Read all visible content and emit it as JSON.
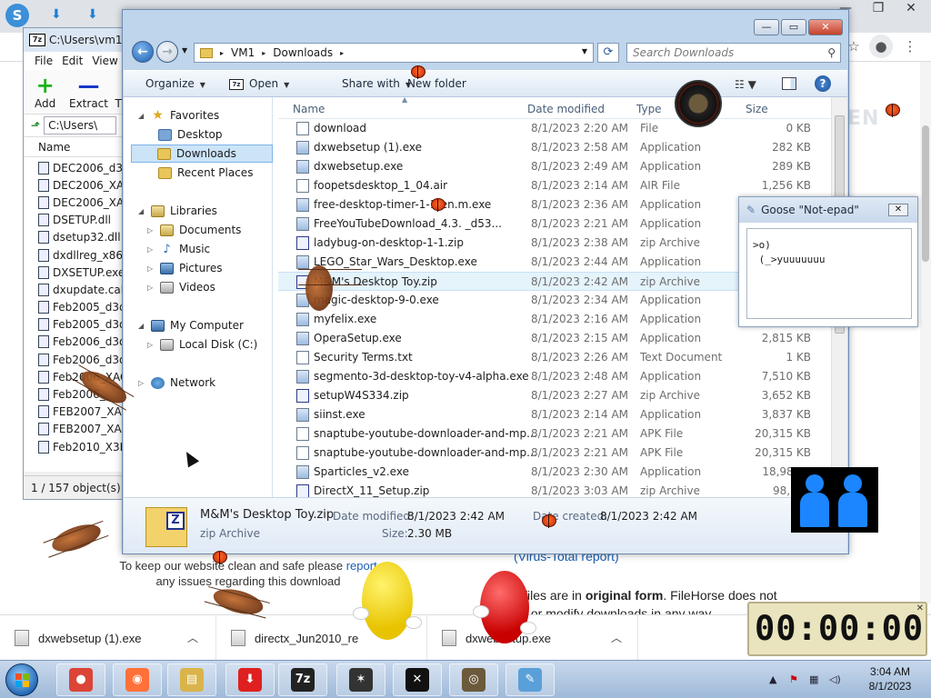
{
  "browser": {
    "window_controls": [
      "—",
      "❐",
      "✕"
    ],
    "watermark": "EN",
    "page_link": "(Virus-Total report)",
    "notice_text": "To keep our website clean and safe please",
    "notice_link": "report",
    "notice_text2": "any issues regarding this download",
    "original_line1_pre": "ll files are in",
    "original_line1_bold": "original form",
    "original_line1_post": ". FileHorse does not",
    "original_line2": "ck or modify downloads in any way"
  },
  "downloads_bar": {
    "items": [
      {
        "name": "dxwebsetup (1).exe"
      },
      {
        "name": "directx_Jun2010_re"
      },
      {
        "name": "dxwebsetup.exe"
      }
    ]
  },
  "sevenzip": {
    "title": "C:\\Users\\vm1\\",
    "logo": "7z",
    "menu": [
      "File",
      "Edit",
      "View"
    ],
    "tools": [
      {
        "label": "Add",
        "symbol": "+",
        "color": "#18b418"
      },
      {
        "label": "Extract",
        "symbol": "—",
        "color": "#1838c8"
      },
      {
        "label": "T",
        "symbol": "",
        "color": "#000000"
      }
    ],
    "path": "C:\\Users\\",
    "column_name": "Name",
    "files": [
      "DEC2006_d3dx",
      "DEC2006_XACT",
      "DEC2006_XACT",
      "DSETUP.dll",
      "dsetup32.dll",
      "dxdllreg_x86.ca",
      "DXSETUP.exe",
      "dxupdate.cab",
      "Feb2005_d3dx",
      "Feb2005_d3dx",
      "Feb2006_d3dx",
      "Feb2006_d3dx",
      "Feb2006_XACT",
      "Feb2006_",
      "FEB2007_XACT",
      "FEB2007_XACT",
      "Feb2010_X3DA"
    ],
    "status": "1 / 157 object(s) se"
  },
  "explorer": {
    "caption_buttons": {
      "minimize": "—",
      "maximize": "▭",
      "close": "✕"
    },
    "address": {
      "parts": [
        "VM1",
        "Downloads"
      ],
      "separator": "▸"
    },
    "search_placeholder": "Search Downloads",
    "commands": {
      "organize": "Organize",
      "open": "Open",
      "share_with": "Share with",
      "new_folder": "New folder",
      "open_badge": "7z"
    },
    "columns": {
      "name": "Name",
      "date": "Date modified",
      "type": "Type",
      "size": "Size"
    },
    "nav": {
      "favorites": "Favorites",
      "desktop": "Desktop",
      "downloads": "Downloads",
      "recent": "Recent Places",
      "libraries": "Libraries",
      "documents": "Documents",
      "music": "Music",
      "pictures": "Pictures",
      "videos": "Videos",
      "computer": "My Computer",
      "local_disk": "Local Disk (C:)",
      "network": "Network"
    },
    "files": [
      {
        "name": "download",
        "date": "8/1/2023 2:20 AM",
        "type": "File",
        "size": "0 KB",
        "kind": "file"
      },
      {
        "name": "dxwebsetup (1).exe",
        "date": "8/1/2023 2:58 AM",
        "type": "Application",
        "size": "282 KB",
        "kind": "exe"
      },
      {
        "name": "dxwebsetup.exe",
        "date": "8/1/2023 2:49 AM",
        "type": "Application",
        "size": "289 KB",
        "kind": "exe"
      },
      {
        "name": "foopetsdesktop_1_04.air",
        "date": "8/1/2023 2:14 AM",
        "type": "AIR File",
        "size": "1,256 KB",
        "kind": "file"
      },
      {
        "name": "free-desktop-timer-1-1-en.m.exe",
        "date": "8/1/2023 2:36 AM",
        "type": "Application",
        "size": "",
        "kind": "exe"
      },
      {
        "name": "FreeYouTubeDownload_4.3.      _d53...",
        "date": "8/1/2023 2:21 AM",
        "type": "Application",
        "size": "",
        "kind": "exe"
      },
      {
        "name": "ladybug-on-desktop-1-1.zip",
        "date": "8/1/2023 2:38 AM",
        "type": "zip Archive",
        "size": "",
        "kind": "zip"
      },
      {
        "name": "LEGO_Star_Wars_Desktop.exe",
        "date": "8/1/2023 2:44 AM",
        "type": "Application",
        "size": "",
        "kind": "exe"
      },
      {
        "name": "M&M's Desktop Toy.zip",
        "date": "8/1/2023 2:42 AM",
        "type": "zip Archive",
        "size": "",
        "kind": "zip"
      },
      {
        "name": "magic-desktop-9-0.exe",
        "date": "8/1/2023 2:34 AM",
        "type": "Application",
        "size": "",
        "kind": "exe"
      },
      {
        "name": "myfelix.exe",
        "date": "8/1/2023 2:16 AM",
        "type": "Application",
        "size": "",
        "kind": "exe"
      },
      {
        "name": "OperaSetup.exe",
        "date": "8/1/2023 2:15 AM",
        "type": "Application",
        "size": "2,815 KB",
        "kind": "exe"
      },
      {
        "name": "Security Terms.txt",
        "date": "8/1/2023 2:26 AM",
        "type": "Text Document",
        "size": "1 KB",
        "kind": "file"
      },
      {
        "name": "segmento-3d-desktop-toy-v4-alpha.exe",
        "date": "8/1/2023 2:48 AM",
        "type": "Application",
        "size": "7,510 KB",
        "kind": "exe"
      },
      {
        "name": "setupW4S334.zip",
        "date": "8/1/2023 2:27 AM",
        "type": "zip Archive",
        "size": "3,652 KB",
        "kind": "zip"
      },
      {
        "name": "siinst.exe",
        "date": "8/1/2023 2:14 AM",
        "type": "Application",
        "size": "3,837 KB",
        "kind": "exe"
      },
      {
        "name": "snaptube-youtube-downloader-and-mp...",
        "date": "8/1/2023 2:21 AM",
        "type": "APK File",
        "size": "20,315 KB",
        "kind": "file"
      },
      {
        "name": "snaptube-youtube-downloader-and-mp...",
        "date": "8/1/2023 2:21 AM",
        "type": "APK File",
        "size": "20,315 KB",
        "kind": "file"
      },
      {
        "name": "Sparticles_v2.exe",
        "date": "8/1/2023 2:30 AM",
        "type": "Application",
        "size": "18,985 K",
        "kind": "exe"
      },
      {
        "name": "DirectX_11_Setup.zip",
        "date": "8/1/2023 3:03 AM",
        "type": "zip Archive",
        "size": "98,297",
        "kind": "zip"
      }
    ],
    "details": {
      "name": "M&M's Desktop Toy.zip",
      "type": "zip Archive",
      "modified_label": "Date modified:",
      "modified": "8/1/2023 2:42 AM",
      "created_label": "Date created:",
      "created": "8/1/2023 2:42 AM",
      "size_label": "Size:",
      "size": "2.30 MB",
      "icon_letter": "Z"
    }
  },
  "goose": {
    "title": "Goose \"Not-epad\"",
    "close": "✕",
    "text": ">o)\n (_>yuuuuuuu"
  },
  "timer": {
    "display": "00:00:00",
    "close": "✕"
  },
  "taskbar": {
    "apps": [
      {
        "name": "chrome",
        "glyph": "●",
        "color": "#db4437"
      },
      {
        "name": "firefox",
        "glyph": "◉",
        "color": "#ff7139"
      },
      {
        "name": "explorer",
        "glyph": "▤",
        "color": "#d9b44a"
      },
      {
        "name": "download",
        "glyph": "⬇",
        "color": "#e02020"
      },
      {
        "name": "7zip",
        "glyph": "7z",
        "color": "#222222"
      },
      {
        "name": "badtz",
        "glyph": "✶",
        "color": "#333333"
      },
      {
        "name": "lightsaber",
        "glyph": "✕",
        "color": "#111111"
      },
      {
        "name": "starwars",
        "glyph": "◎",
        "color": "#6b5a3c"
      },
      {
        "name": "notepad",
        "glyph": "✎",
        "color": "#5aa0d8"
      }
    ],
    "clock_time": "3:04 AM",
    "clock_date": "8/1/2023"
  }
}
